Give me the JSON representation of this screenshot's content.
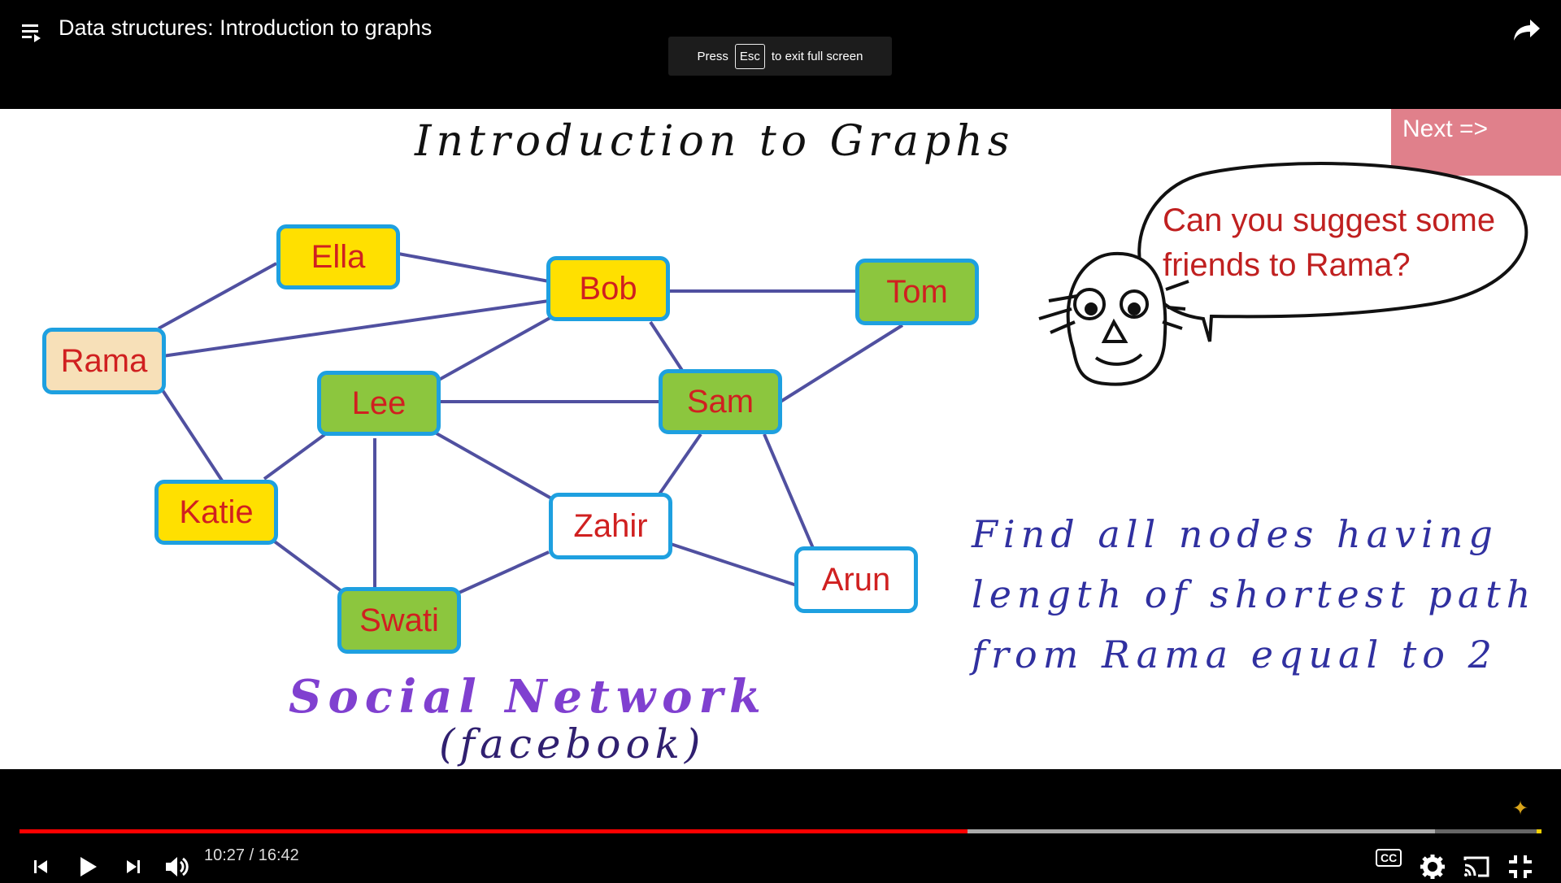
{
  "player": {
    "title": "Data structures: Introduction to graphs",
    "esc_before": "Press",
    "esc_key": "Esc",
    "esc_after": "to exit full screen",
    "time_current": "10:27",
    "time_total": "16:42",
    "time_separator": " / ",
    "progress_played": 0.623,
    "progress_buffered": 0.93,
    "cc_label": "CC"
  },
  "slide": {
    "title": "Introduction to Graphs",
    "next_label": "Next =>",
    "bubble_text": "Can you suggest some friends to Rama?",
    "social_label": "Social Network",
    "facebook_label": "(facebook)",
    "find_text": "Find all nodes having length of shortest path from Rama equal to 2",
    "nodes": [
      "Ella",
      "Bob",
      "Tom",
      "Rama",
      "Lee",
      "Sam",
      "Katie",
      "Zahir",
      "Arun",
      "Swati"
    ],
    "edges": [
      [
        "Rama",
        "Ella"
      ],
      [
        "Rama",
        "Bob"
      ],
      [
        "Rama",
        "Katie"
      ],
      [
        "Ella",
        "Bob"
      ],
      [
        "Bob",
        "Tom"
      ],
      [
        "Bob",
        "Lee"
      ],
      [
        "Bob",
        "Sam"
      ],
      [
        "Tom",
        "Sam"
      ],
      [
        "Lee",
        "Sam"
      ],
      [
        "Lee",
        "Katie"
      ],
      [
        "Lee",
        "Swati"
      ],
      [
        "Lee",
        "Zahir"
      ],
      [
        "Sam",
        "Zahir"
      ],
      [
        "Sam",
        "Arun"
      ],
      [
        "Katie",
        "Swati"
      ],
      [
        "Swati",
        "Zahir"
      ],
      [
        "Zahir",
        "Arun"
      ]
    ]
  },
  "colors": {
    "progress": "#ff0000",
    "next_button": "#e0808b",
    "node_border": "#1ea0e0",
    "edge": "#5050a0"
  }
}
